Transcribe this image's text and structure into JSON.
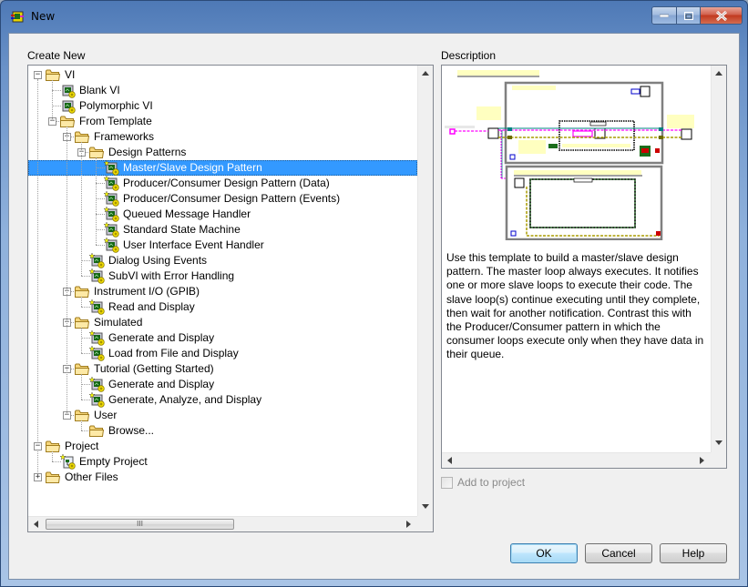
{
  "window": {
    "title": "New",
    "icons": {
      "app": "labview-vi-icon",
      "minimize": "minimize-icon",
      "maximize": "maximize-icon",
      "close": "close-icon"
    }
  },
  "create_new": {
    "label": "Create New",
    "tree": [
      {
        "label": "VI",
        "icon": "folder-icon",
        "level": 0,
        "expander": "minus"
      },
      {
        "label": "Blank VI",
        "icon": "vi-icon",
        "level": 1
      },
      {
        "label": "Polymorphic VI",
        "icon": "vi-icon",
        "level": 1
      },
      {
        "label": "From Template",
        "icon": "folder-icon",
        "level": 1,
        "expander": "minus"
      },
      {
        "label": "Frameworks",
        "icon": "folder-icon",
        "level": 2,
        "expander": "minus"
      },
      {
        "label": "Design Patterns",
        "icon": "folder-icon",
        "level": 3,
        "expander": "minus"
      },
      {
        "label": "Master/Slave Design Pattern",
        "icon": "template-vi-icon",
        "level": 4,
        "selected": true
      },
      {
        "label": "Producer/Consumer Design Pattern (Data)",
        "icon": "template-vi-icon",
        "level": 4
      },
      {
        "label": "Producer/Consumer Design Pattern (Events)",
        "icon": "template-vi-icon",
        "level": 4
      },
      {
        "label": "Queued Message Handler",
        "icon": "template-vi-icon",
        "level": 4
      },
      {
        "label": "Standard State Machine",
        "icon": "template-vi-icon",
        "level": 4
      },
      {
        "label": "User Interface Event Handler",
        "icon": "template-vi-icon",
        "level": 4
      },
      {
        "label": "Dialog Using Events",
        "icon": "template-vi-icon",
        "level": 3
      },
      {
        "label": "SubVI with Error Handling",
        "icon": "template-vi-icon",
        "level": 3
      },
      {
        "label": "Instrument I/O (GPIB)",
        "icon": "folder-icon",
        "level": 2,
        "expander": "minus"
      },
      {
        "label": "Read and Display",
        "icon": "template-vi-icon",
        "level": 3
      },
      {
        "label": "Simulated",
        "icon": "folder-icon",
        "level": 2,
        "expander": "minus"
      },
      {
        "label": "Generate and Display",
        "icon": "template-vi-icon",
        "level": 3
      },
      {
        "label": "Load from File and Display",
        "icon": "template-vi-icon",
        "level": 3
      },
      {
        "label": "Tutorial (Getting Started)",
        "icon": "folder-icon",
        "level": 2,
        "expander": "minus"
      },
      {
        "label": "Generate and Display",
        "icon": "template-vi-icon",
        "level": 3
      },
      {
        "label": "Generate, Analyze, and Display",
        "icon": "template-vi-icon",
        "level": 3
      },
      {
        "label": "User",
        "icon": "folder-icon",
        "level": 2,
        "expander": "minus"
      },
      {
        "label": "Browse...",
        "icon": "folder-icon",
        "level": 3
      },
      {
        "label": "Project",
        "icon": "folder-icon",
        "level": 0,
        "expander": "minus"
      },
      {
        "label": "Empty Project",
        "icon": "project-icon",
        "level": 1
      },
      {
        "label": "Other Files",
        "icon": "folder-icon",
        "level": 0,
        "expander": "plus"
      }
    ],
    "hscroll_thumb_glyph": "III"
  },
  "description": {
    "label": "Description",
    "text": "Use this template to build a master/slave design pattern. The master loop always executes. It notifies one or more slave loops to execute their code. The slave loop(s) continue executing until they complete, then wait for another notification. Contrast this with the Producer/Consumer pattern in which the consumer loops execute only when they have data in their queue.",
    "preview": "block-diagram-preview"
  },
  "add_to_project": {
    "label": "Add to project",
    "checked": false,
    "enabled": false
  },
  "buttons": {
    "ok": "OK",
    "cancel": "Cancel",
    "help": "Help"
  },
  "colors": {
    "selection": "#3399ff",
    "wire_pink": "#ff00ff",
    "wire_teal": "#008080",
    "wire_yellow": "#e6d200",
    "loop_border": "#7f7f7f"
  }
}
